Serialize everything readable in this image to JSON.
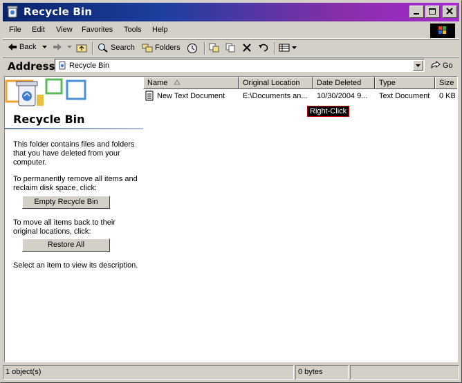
{
  "window": {
    "title": "Recycle Bin"
  },
  "menu": [
    "File",
    "Edit",
    "View",
    "Favorites",
    "Tools",
    "Help"
  ],
  "toolbar": {
    "back": "Back",
    "search": "Search",
    "folders": "Folders"
  },
  "address": {
    "label": "Address",
    "value": "Recycle Bin",
    "go": "Go"
  },
  "side": {
    "title": "Recycle Bin",
    "intro": "This folder contains files and folders that you have deleted from your computer.",
    "empty_text": "To permanently remove all items and reclaim disk space, click:",
    "empty_button": "Empty Recycle Bin",
    "restore_text": "To move all items back to their original locations, click:",
    "restore_button": "Restore All",
    "hint": "Select an item to view its description."
  },
  "columns": [
    "Name",
    "Original Location",
    "Date Deleted",
    "Type",
    "Size"
  ],
  "rows": [
    {
      "name": "New Text Document",
      "location": "E:\\Documents an...",
      "date": "10/30/2004 9...",
      "type": "Text Document",
      "size": "0 KB"
    }
  ],
  "annotation": "Right-Click",
  "status": {
    "objects": "1 object(s)",
    "bytes": "0 bytes"
  },
  "colors": {
    "title_start": "#0a246a",
    "title_end": "#a52bd2",
    "face": "#d4d0c8",
    "callout_border": "#c00000"
  }
}
